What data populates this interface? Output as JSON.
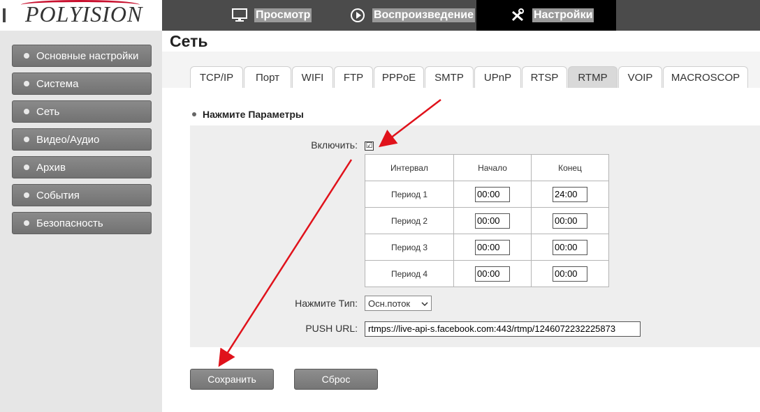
{
  "brand": {
    "logo_text": "POLYISION"
  },
  "nav": [
    {
      "label": "Просмотр",
      "icon": "monitor-icon"
    },
    {
      "label": "Воспроизведение",
      "icon": "play-circle-icon"
    },
    {
      "label": "Настройки",
      "icon": "tools-icon"
    }
  ],
  "sidebar": {
    "items": [
      {
        "label": "Основные настройки"
      },
      {
        "label": "Система"
      },
      {
        "label": "Сеть"
      },
      {
        "label": "Видео/Аудио"
      },
      {
        "label": "Архив"
      },
      {
        "label": "События"
      },
      {
        "label": "Безопасность"
      }
    ]
  },
  "page": {
    "title": "Сеть"
  },
  "tabs": [
    "TCP/IP",
    "Порт",
    "WIFI",
    "FTP",
    "PPPoE",
    "SMTP",
    "UPnP",
    "RTSP",
    "RTMP",
    "VOIP",
    "MACROSCOP"
  ],
  "active_tab": "RTMP",
  "section": {
    "title": "Нажмите Параметры"
  },
  "form": {
    "enable_label": "Включить:",
    "enable_checked": "☑",
    "schedule": {
      "headers": [
        "Интервал",
        "Начало",
        "Конец"
      ],
      "rows": [
        {
          "name": "Период 1",
          "start": "00:00",
          "end": "24:00"
        },
        {
          "name": "Период 2",
          "start": "00:00",
          "end": "00:00"
        },
        {
          "name": "Период 3",
          "start": "00:00",
          "end": "00:00"
        },
        {
          "name": "Период 4",
          "start": "00:00",
          "end": "00:00"
        }
      ]
    },
    "type_label": "Нажмите Тип:",
    "type_value": "Осн.поток",
    "url_label": "PUSH URL:",
    "url_value": "rtmps://live-api-s.facebook.com:443/rtmp/1246072232225873"
  },
  "buttons": {
    "save": "Сохранить",
    "reset": "Сброс"
  },
  "colors": {
    "accent_red": "#e0121b",
    "topbar": "#4b4b4b",
    "sidebar": "#e6e6e6"
  }
}
